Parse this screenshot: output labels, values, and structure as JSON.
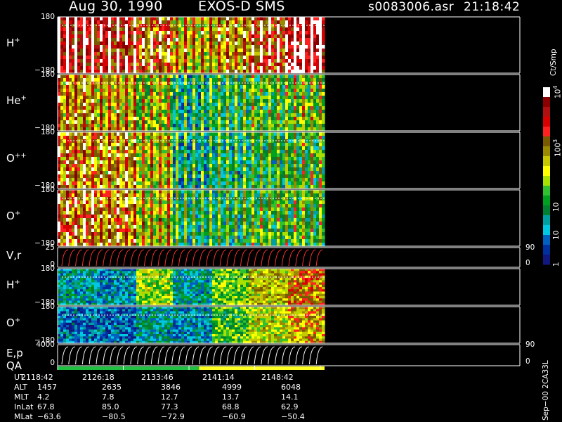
{
  "header": {
    "date": "Aug 30, 1990",
    "instrument": "EXOS-D SMS",
    "file": "s0083006.asr",
    "time": "21:18:42"
  },
  "colorbar": {
    "unit_label": "Ct/Smp",
    "ticks": [
      "10",
      "100",
      "10",
      "10",
      "1"
    ],
    "tick_exponents": [
      "4",
      "3",
      "",
      "",
      ""
    ],
    "tick_fractions": [
      0.03,
      0.36,
      0.67,
      0.83,
      0.98
    ],
    "colors": [
      "#ffffff",
      "#8a0000",
      "#b01010",
      "#d80000",
      "#ff2020",
      "#7a5a00",
      "#9a8a00",
      "#c8c800",
      "#ffff00",
      "#a8e000",
      "#30c030",
      "#00a020",
      "#008030",
      "#00a0a0",
      "#00c8e0",
      "#0060c0",
      "#0030a0",
      "#101880"
    ]
  },
  "panels": [
    {
      "label": "H",
      "sup": "+",
      "top": "180",
      "bottom": "−180",
      "rtop": "",
      "rbottom": ""
    },
    {
      "label": "He",
      "sup": "+",
      "top": "180",
      "bottom": "−180",
      "rtop": "",
      "rbottom": ""
    },
    {
      "label": "O",
      "sup": "++",
      "top": "180",
      "bottom": "−180",
      "rtop": "",
      "rbottom": ""
    },
    {
      "label": "O",
      "sup": "+",
      "top": "180",
      "bottom": "−180",
      "rtop": "",
      "rbottom": ""
    },
    {
      "label": "V,r",
      "sup": "",
      "top": "25",
      "bottom": "0",
      "rtop": "90",
      "rbottom": "0"
    },
    {
      "label": "H",
      "sup": "+",
      "top": "180",
      "bottom": "−180",
      "rtop": "",
      "rbottom": ""
    },
    {
      "label": "O",
      "sup": "+",
      "top": "180",
      "bottom": "−180",
      "rtop": "",
      "rbottom": ""
    },
    {
      "label": "E,p",
      "sup": "",
      "top": "4000",
      "bottom": "0",
      "rtop": "90",
      "rbottom": "0"
    }
  ],
  "qa_label": "QA",
  "qa_segments": [
    {
      "from": 0.0,
      "to": 0.53,
      "color": "#20c040"
    },
    {
      "from": 0.53,
      "to": 1.0,
      "color": "#ffff20"
    }
  ],
  "footer": {
    "labels": [
      "UT",
      "ALT",
      "MLT",
      "InLat",
      "MLat"
    ],
    "columns": [
      [
        "2118:42",
        "1457",
        "4.2",
        "67.8",
        "−63.6"
      ],
      [
        "2126:18",
        "2635",
        "7.8",
        "85.0",
        "−80.5"
      ],
      [
        "2133:46",
        "3846",
        "12.7",
        "77.3",
        "−72.9"
      ],
      [
        "2141:14",
        "4999",
        "13.7",
        "68.8",
        "−60.9"
      ],
      [
        "2148:42",
        "6048",
        "14.1",
        "62.9",
        "−50.4"
      ]
    ],
    "side_label": "Sep−00  2CA33L"
  },
  "chart_data": {
    "type": "heatmap",
    "x_ticks": [
      "2118:42",
      "2126:18",
      "2133:46",
      "2141:14",
      "2148:42"
    ],
    "data_extent_fraction": 0.5,
    "color_scale_range": [
      1,
      10000
    ],
    "color_scale": "log",
    "panels": [
      {
        "name": "H+",
        "ylim": [
          -180,
          180
        ],
        "intensity_profile": [
          0.85,
          0.8,
          0.7,
          0.55,
          0.6,
          0.75,
          0.9
        ]
      },
      {
        "name": "He+",
        "ylim": [
          -180,
          180
        ],
        "intensity_profile": [
          0.6,
          0.55,
          0.45,
          0.2,
          0.3,
          0.35,
          0.4
        ]
      },
      {
        "name": "O++",
        "ylim": [
          -180,
          180
        ],
        "intensity_profile": [
          0.65,
          0.6,
          0.5,
          0.2,
          0.25,
          0.3,
          0.35
        ]
      },
      {
        "name": "O+",
        "ylim": [
          -180,
          180
        ],
        "intensity_profile": [
          0.7,
          0.65,
          0.5,
          0.25,
          0.3,
          0.35,
          0.35
        ]
      },
      {
        "name": "H+",
        "ylim": [
          -180,
          180
        ],
        "intensity_profile": [
          0.2,
          0.15,
          0.45,
          0.2,
          0.4,
          0.55,
          0.65
        ]
      },
      {
        "name": "O+",
        "ylim": [
          -180,
          180
        ],
        "intensity_profile": [
          0.1,
          0.1,
          0.2,
          0.15,
          0.35,
          0.5,
          0.6
        ]
      }
    ]
  }
}
